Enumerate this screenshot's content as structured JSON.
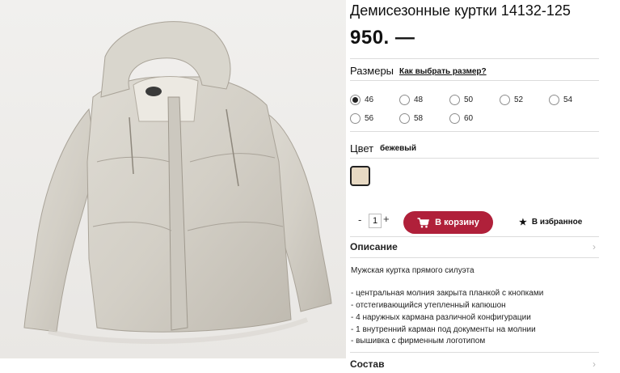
{
  "product": {
    "title": "Демисезонные куртки 14132-125",
    "price": "950. —",
    "photo_alt": "beige-jacket-photo"
  },
  "sizes": {
    "label": "Размеры",
    "guide_link": "Как выбрать размер?",
    "selected": "46",
    "options": [
      "46",
      "48",
      "50",
      "52",
      "54",
      "56",
      "58",
      "60"
    ]
  },
  "color": {
    "label": "Цвет",
    "value": "бежевый",
    "swatch_hex": "#e7d9c3"
  },
  "purchase": {
    "qty_minus": "-",
    "quantity": "1",
    "qty_plus": "+",
    "cart_label": "В корзину",
    "cart_icon": "cart-icon",
    "cart_color": "#b0203a",
    "favorite_label": "В избранное",
    "favorite_icon": "★"
  },
  "description": {
    "title": "Описание",
    "chevron": "›",
    "lines": [
      "Мужская куртка прямого силуэта",
      "- центральная молния закрыта планкой с кнопками",
      "- отстегивающийся утепленный капюшон",
      "- 4 наружных кармана различной конфигурации",
      "- 1 внутренний карман под документы на молнии",
      "- вышивка с фирменным логотипом"
    ]
  },
  "composition": {
    "title": "Состав",
    "chevron": "›"
  }
}
